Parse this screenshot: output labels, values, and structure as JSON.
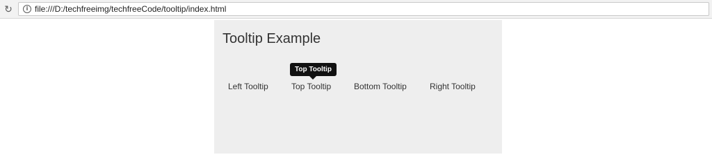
{
  "browser": {
    "url": "file:///D:/techfreeimg/techfreeCode/tooltip/index.html"
  },
  "page": {
    "title": "Tooltip Example",
    "links": {
      "left": "Left Tooltip",
      "top": "Top Tooltip",
      "bottom": "Bottom Tooltip",
      "right": "Right Tooltip"
    },
    "tooltip": {
      "text": "Top Tooltip"
    }
  }
}
